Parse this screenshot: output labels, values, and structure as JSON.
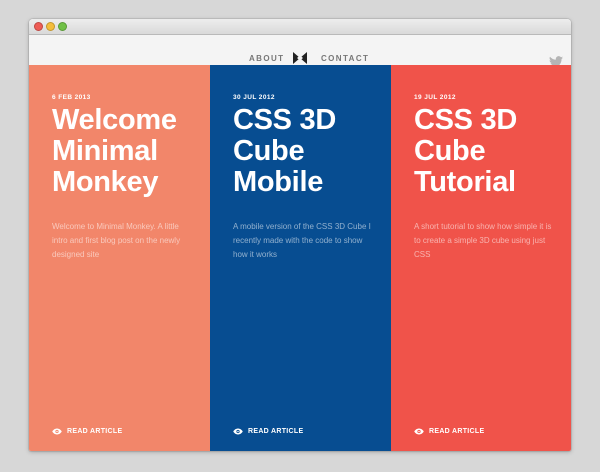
{
  "nav": {
    "about": "ABOUT",
    "contact": "CONTACT",
    "logo_icon": "monkey-logo-icon",
    "social_icon": "twitter-icon"
  },
  "colors": {
    "col1": "#f2866a",
    "col2": "#074d91",
    "col3": "#f0534a"
  },
  "posts": [
    {
      "date": "6 FEB 2013",
      "title": "Welcome Minimal Monkey",
      "excerpt": "Welcome to Minimal Monkey. A little intro and first blog post on the newly designed site",
      "cta": "READ ARTICLE"
    },
    {
      "date": "30 JUL 2012",
      "title": "CSS 3D Cube Mobile",
      "excerpt": "A mobile version of the CSS 3D Cube I recently made with the code to show how it works",
      "cta": "READ ARTICLE"
    },
    {
      "date": "19 JUL 2012",
      "title": "CSS 3D Cube Tutorial",
      "excerpt": "A short tutorial to show how simple it is to create a simple 3D cube using just CSS",
      "cta": "READ ARTICLE"
    }
  ]
}
